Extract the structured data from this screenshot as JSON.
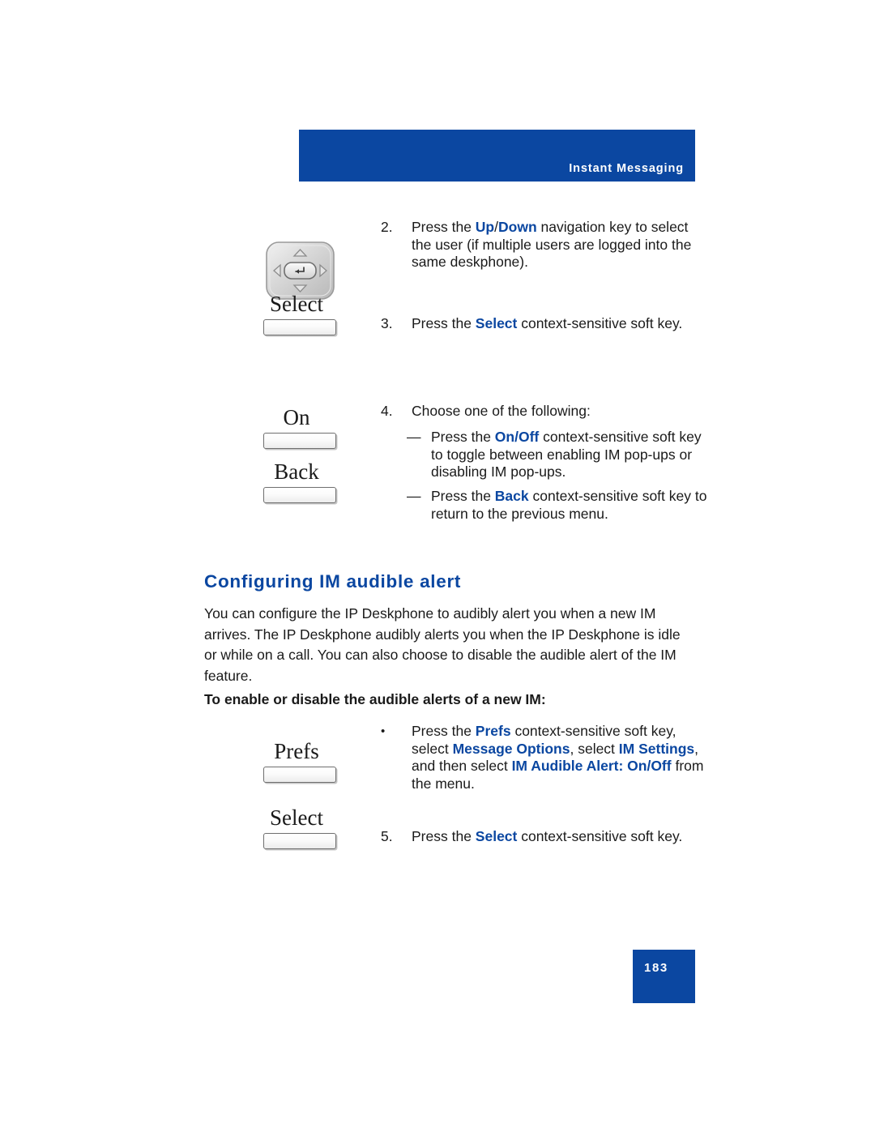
{
  "header": {
    "title": "Instant Messaging"
  },
  "page_badge": {
    "number": "183"
  },
  "icons": {
    "navigation_key": "navigation-cluster-key",
    "enter_glyph": "enter-arrow"
  },
  "softkeys": [
    {
      "label": "Select",
      "name": "select"
    },
    {
      "label": "On",
      "name": "on"
    },
    {
      "label": "Back",
      "name": "back"
    },
    {
      "label": "Prefs",
      "name": "prefs"
    },
    {
      "label": "Select",
      "name": "select-2"
    }
  ],
  "steps": {
    "step2": {
      "number": "2.",
      "t1": "Press the ",
      "kw1": "Up",
      "sep1": "/",
      "kw2": "Down",
      "t2": " navigation key to select the user (if multiple users are logged into the same deskphone)."
    },
    "step3": {
      "number": "3.",
      "t1": "Press the ",
      "kw1": "Select",
      "t2": " context-sensitive soft key."
    },
    "step4": {
      "number": "4.",
      "t1": "Choose one of the following:"
    },
    "sub1": {
      "mark": "—",
      "t1": "Press the ",
      "kw1": "On/Off",
      "t2": " context-sensitive soft key to toggle between enabling IM pop-ups or disabling IM pop-ups."
    },
    "sub2": {
      "mark": "—",
      "t1": "Press the ",
      "kw1": "Back",
      "t2": " context-sensitive soft key to return to the previous menu."
    },
    "step5": {
      "number": "5.",
      "t1": "Press the ",
      "kw1": "Select",
      "t2": " context-sensitive soft key."
    }
  },
  "section": {
    "heading": "Configuring IM audible alert",
    "paragraph": "You can configure the IP Deskphone to audibly alert you when a new IM arrives. The IP Deskphone audibly alerts you when the IP Deskphone is idle or while on a call. You can also choose to disable the audible alert of the IM feature.",
    "sub_heading": "To enable or disable the audible alerts of a new IM:",
    "bullet": {
      "mark": "•",
      "t1": "Press the ",
      "kw1": "Prefs",
      "t2": " context-sensitive soft key, select ",
      "kw2": "Message Options",
      "t3": ", select ",
      "kw3": "IM Settings",
      "t4": ", and then select ",
      "kw4": "IM Audible Alert: On/Off",
      "t5": " from the menu."
    }
  },
  "colors": {
    "brand_blue": "#0B47A1",
    "text_black": "#1a1a1a",
    "white": "#ffffff"
  }
}
